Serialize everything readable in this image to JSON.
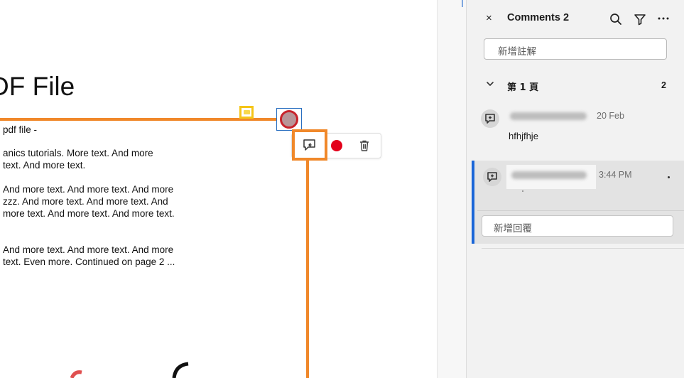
{
  "document": {
    "title": "DF File",
    "lines": [
      "pdf file -",
      "anics tutorials. More text. And more",
      " text. And more text.",
      " And more text. And more text. And more",
      " zzz. And more text. And more text. And",
      " more text. And more text. And more text.",
      " And more text. And more text. And more",
      " text. Even more. Continued on page 2 ..."
    ]
  },
  "annotation_toolbar": {
    "buttons": [
      "comment-reply",
      "color-red",
      "delete"
    ],
    "accent_color": "#f0882a",
    "color_swatch": "#e3001b"
  },
  "panel": {
    "close": "×",
    "title": "Comments 2",
    "new_comment_placeholder": "新增註解",
    "page_group": {
      "label": "第 1 頁",
      "count": "2"
    },
    "comments": [
      {
        "time": "20 Feb",
        "text": "hfhjfhje"
      },
      {
        "time": "3:44 PM",
        "text": ""
      }
    ],
    "reply_placeholder": "新增回覆",
    "selected_color": "#1a66d8"
  }
}
